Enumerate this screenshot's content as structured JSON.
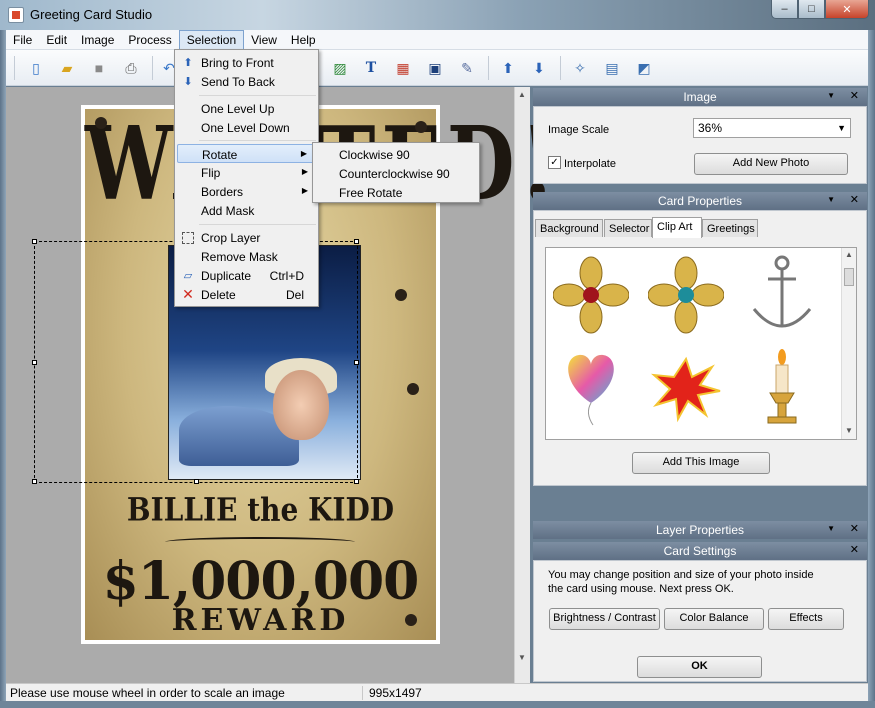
{
  "window": {
    "title": "Greeting Card Studio",
    "min": "–",
    "max": "□",
    "close": "✕"
  },
  "menubar": [
    "File",
    "Edit",
    "Image",
    "Process",
    "Selection",
    "View",
    "Help"
  ],
  "selection_menu": {
    "bring_front": "Bring to Front",
    "send_back": "Send To Back",
    "level_up": "One Level Up",
    "level_down": "One Level Down",
    "rotate": "Rotate",
    "flip": "Flip",
    "borders": "Borders",
    "add_mask": "Add Mask",
    "crop_layer": "Crop Layer",
    "remove_mask": "Remove Mask",
    "duplicate": "Duplicate",
    "duplicate_sc": "Ctrl+D",
    "delete": "Delete",
    "delete_sc": "Del"
  },
  "rotate_submenu": [
    "Clockwise 90",
    "Counterclockwise 90",
    "Free Rotate"
  ],
  "card": {
    "wanted": "WANTED!",
    "name": "BILLIE the KIDD",
    "amount": "$1,000,000",
    "reward": "REWARD"
  },
  "image_panel": {
    "title": "Image",
    "scale_label": "Image Scale",
    "scale_value": "36%",
    "interpolate_label": "Interpolate",
    "interpolate_checked": true,
    "add_photo": "Add New Photo"
  },
  "card_properties": {
    "title": "Card Properties",
    "tabs": [
      "Background",
      "Selector",
      "Clip Art",
      "Greetings"
    ],
    "active_tab": "Clip Art",
    "add_image": "Add This Image"
  },
  "layer_properties": {
    "title": "Layer Properties"
  },
  "card_settings": {
    "title": "Card Settings",
    "instruction_line1": "You may change position and size of your photo inside",
    "instruction_line2": "the card using mouse. Next press OK.",
    "brightness": "Brightness / Contrast",
    "color_balance": "Color Balance",
    "effects": "Effects",
    "ok": "OK"
  },
  "status": {
    "hint": "Please use mouse wheel in order to scale an image",
    "dimensions": "995x1497"
  }
}
